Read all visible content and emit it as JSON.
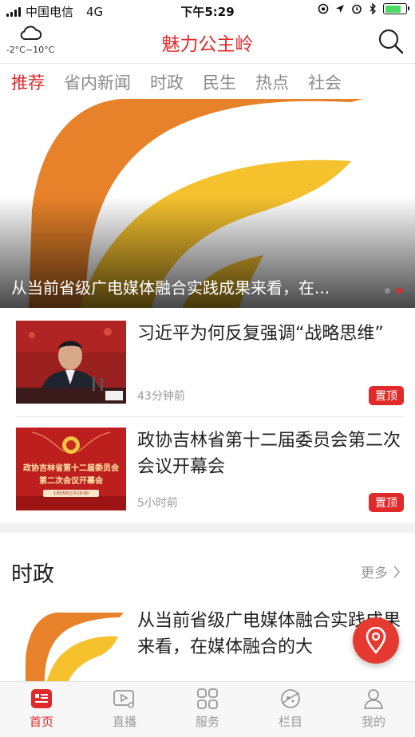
{
  "status_bar": {
    "carrier": "中国电信",
    "network": "4G",
    "time": "下午5:29"
  },
  "header": {
    "title": "魅力公主岭",
    "weather_temp": "-2°C~10°C",
    "weather_icon": "cloud-icon",
    "search_icon": "search-icon"
  },
  "tabs": [
    {
      "label": "推荐",
      "active": true
    },
    {
      "label": "省内新闻"
    },
    {
      "label": "时政"
    },
    {
      "label": "民生"
    },
    {
      "label": "热点"
    },
    {
      "label": "社会"
    }
  ],
  "banner": {
    "title": "从当前省级广电媒体融合实践成果来看，在...",
    "active_dot": 2,
    "dot_count": 2
  },
  "news": [
    {
      "title": "习近平为何反复强调“战略思维”",
      "time": "43分钟前",
      "badge": "置顶"
    },
    {
      "title": "政协吉林省第十二届委员会第二次会议开幕会",
      "time": "5小时前",
      "badge": "置顶",
      "thumb_line1": "政协吉林省第十二届委员会",
      "thumb_line2": "第二次会议开幕会",
      "thumb_date": "1月25日上午10:00"
    }
  ],
  "section": {
    "title": "时政",
    "more": "更多",
    "item_title": "从当前省级广电媒体融合实践成果来看，在媒体融合的大"
  },
  "bottom_nav": [
    {
      "label": "首页",
      "icon": "news-home-icon",
      "active": true
    },
    {
      "label": "直播",
      "icon": "live-video-icon"
    },
    {
      "label": "服务",
      "icon": "grid-services-icon"
    },
    {
      "label": "栏目",
      "icon": "planet-columns-icon"
    },
    {
      "label": "我的",
      "icon": "user-profile-icon"
    }
  ],
  "colors": {
    "accent": "#e0292a",
    "logo_orange": "#e8822a",
    "logo_yellow": "#f5c22e"
  }
}
